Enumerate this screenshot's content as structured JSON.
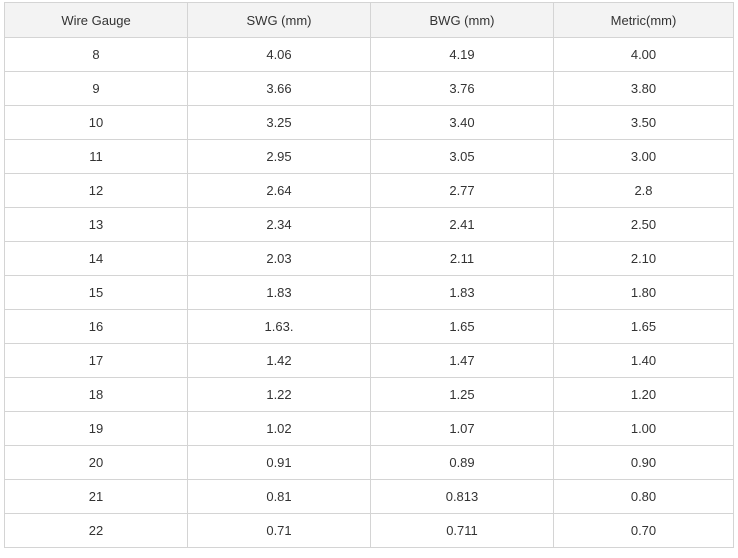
{
  "table": {
    "headers": [
      "Wire Gauge",
      "SWG (mm)",
      "BWG (mm)",
      "Metric(mm)"
    ],
    "rows": [
      [
        "8",
        "4.06",
        "4.19",
        "4.00"
      ],
      [
        "9",
        "3.66",
        "3.76",
        "3.80"
      ],
      [
        "10",
        "3.25",
        "3.40",
        "3.50"
      ],
      [
        "11",
        "2.95",
        "3.05",
        "3.00"
      ],
      [
        "12",
        "2.64",
        "2.77",
        "2.8"
      ],
      [
        "13",
        "2.34",
        "2.41",
        "2.50"
      ],
      [
        "14",
        "2.03",
        "2.11",
        "2.10"
      ],
      [
        "15",
        "1.83",
        "1.83",
        "1.80"
      ],
      [
        "16",
        "1.63.",
        "1.65",
        "1.65"
      ],
      [
        "17",
        "1.42",
        "1.47",
        "1.40"
      ],
      [
        "18",
        "1.22",
        "1.25",
        "1.20"
      ],
      [
        "19",
        "1.02",
        "1.07",
        "1.00"
      ],
      [
        "20",
        "0.91",
        "0.89",
        "0.90"
      ],
      [
        "21",
        "0.81",
        "0.813",
        "0.80"
      ],
      [
        "22",
        "0.71",
        "0.711",
        "0.70"
      ]
    ]
  },
  "colors": {
    "header_background": "#f3f3f3",
    "border": "#d4d4d4",
    "text": "#333333"
  }
}
